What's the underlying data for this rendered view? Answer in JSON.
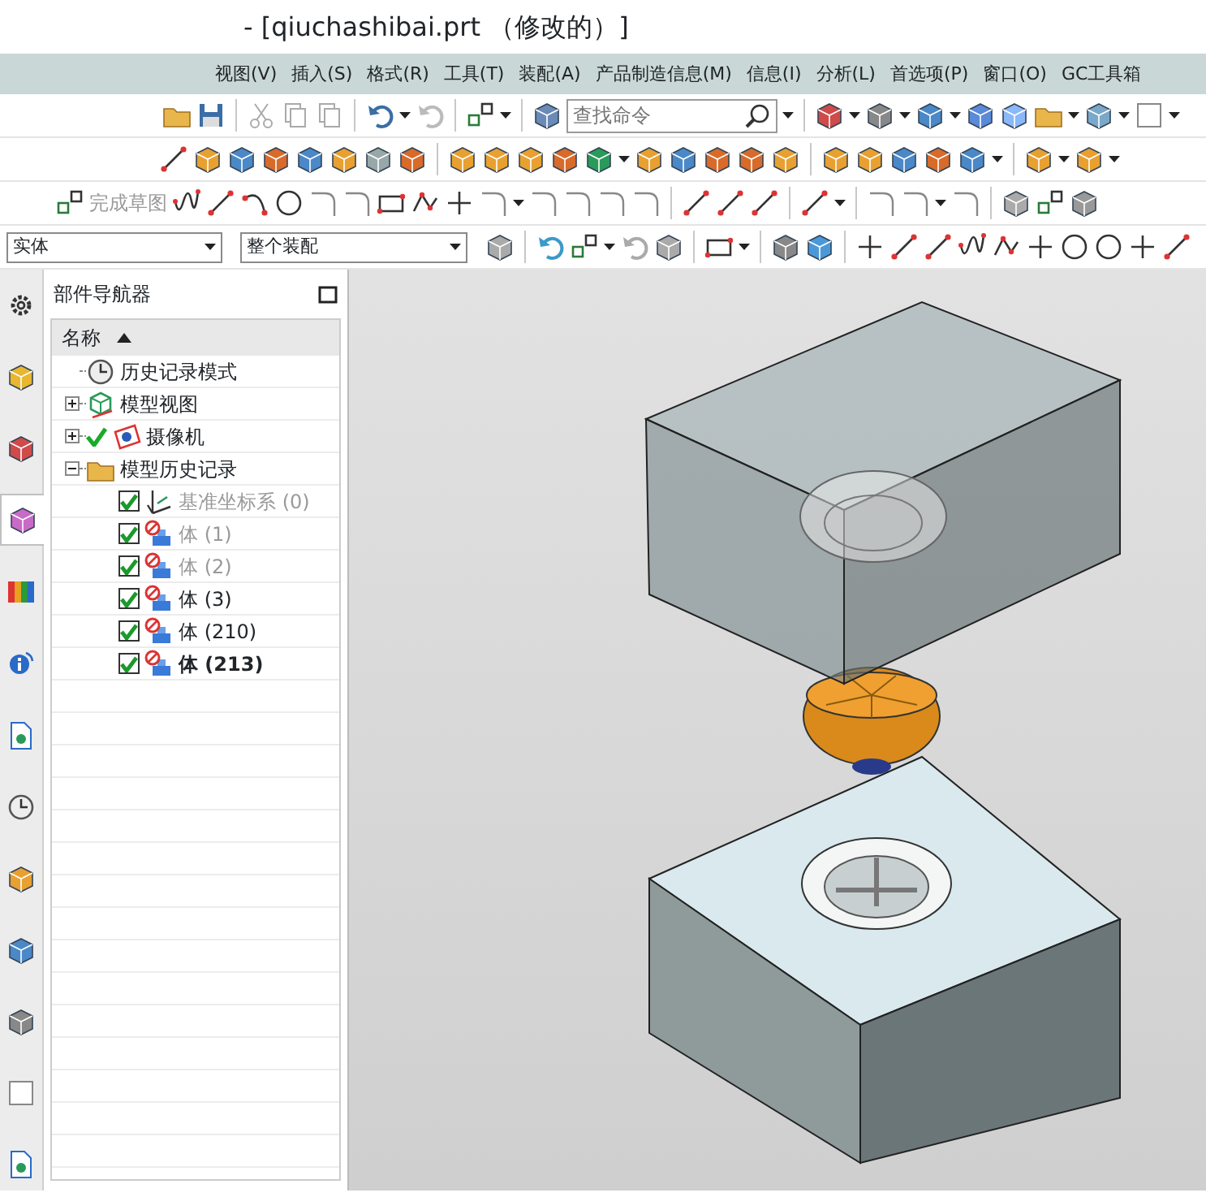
{
  "window": {
    "title": "- [qiuchashibai.prt （修改的）]"
  },
  "menu": [
    "视图(V)",
    "插入(S)",
    "格式(R)",
    "工具(T)",
    "装配(A)",
    "产品制造信息(M)",
    "信息(I)",
    "分析(L)",
    "首选项(P)",
    "窗口(O)",
    "GC工具箱"
  ],
  "toolbar": {
    "search": {
      "placeholder": "查找命令"
    },
    "finish_sketch": {
      "label": "完成草图",
      "disabled": true
    },
    "filters": [
      {
        "value": "实体"
      },
      {
        "value": "整个装配"
      }
    ]
  },
  "side_tabs": [
    {
      "selected": false
    },
    {
      "selected": false
    },
    {
      "selected": false
    },
    {
      "selected": true
    },
    {
      "selected": false
    },
    {
      "selected": false
    },
    {
      "selected": false
    },
    {
      "selected": false
    },
    {
      "selected": false
    },
    {
      "selected": false
    },
    {
      "selected": false
    },
    {
      "selected": false
    },
    {
      "selected": false
    }
  ],
  "navigator": {
    "title": "部件导航器",
    "column": "名称",
    "tree": [
      {
        "kind": "history",
        "label": "历史记录模式"
      },
      {
        "kind": "views",
        "label": "模型视图",
        "expanded": false
      },
      {
        "kind": "camera",
        "label": "摄像机",
        "expanded": false
      },
      {
        "kind": "folder",
        "label": "模型历史记录",
        "expanded": true,
        "children": [
          {
            "kind": "datum",
            "label": "基准坐标系 (0)",
            "checked": true,
            "disabled": true,
            "current": false
          },
          {
            "kind": "body",
            "label": "体 (1)",
            "checked": true,
            "disabled": true,
            "current": false
          },
          {
            "kind": "body",
            "label": "体 (2)",
            "checked": true,
            "disabled": true,
            "current": false
          },
          {
            "kind": "body",
            "label": "体 (3)",
            "checked": true,
            "disabled": false,
            "current": false
          },
          {
            "kind": "body",
            "label": "体 (210)",
            "checked": true,
            "disabled": false,
            "current": false
          },
          {
            "kind": "body",
            "label": "体 (213)",
            "checked": true,
            "disabled": false,
            "current": true
          }
        ]
      }
    ]
  }
}
